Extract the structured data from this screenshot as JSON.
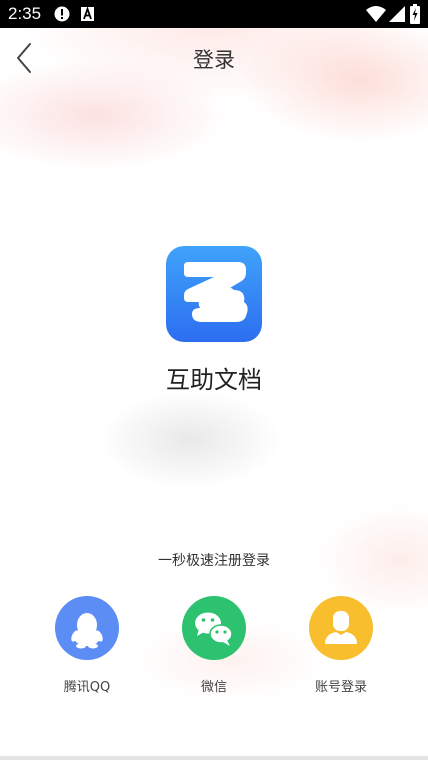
{
  "status_bar": {
    "time": "2:35",
    "icons": [
      "alert-circle-icon",
      "a-box-icon",
      "wifi-icon",
      "signal-icon",
      "battery-charging-icon"
    ]
  },
  "header": {
    "title": "登录",
    "back_icon": "chevron-left-icon"
  },
  "app": {
    "name": "互助文档",
    "logo_icon": "z-logo-icon"
  },
  "login": {
    "tagline": "一秒极速注册登录",
    "options": [
      {
        "label": "腾讯QQ",
        "icon": "qq-penguin-icon",
        "color": "#5B8DF5"
      },
      {
        "label": "微信",
        "icon": "wechat-icon",
        "color": "#2CC26F"
      },
      {
        "label": "账号登录",
        "icon": "user-icon",
        "color": "#F8BE2D"
      }
    ]
  },
  "colors": {
    "logo_top": "#3FA3FB",
    "logo_bottom": "#2D6EF0"
  }
}
